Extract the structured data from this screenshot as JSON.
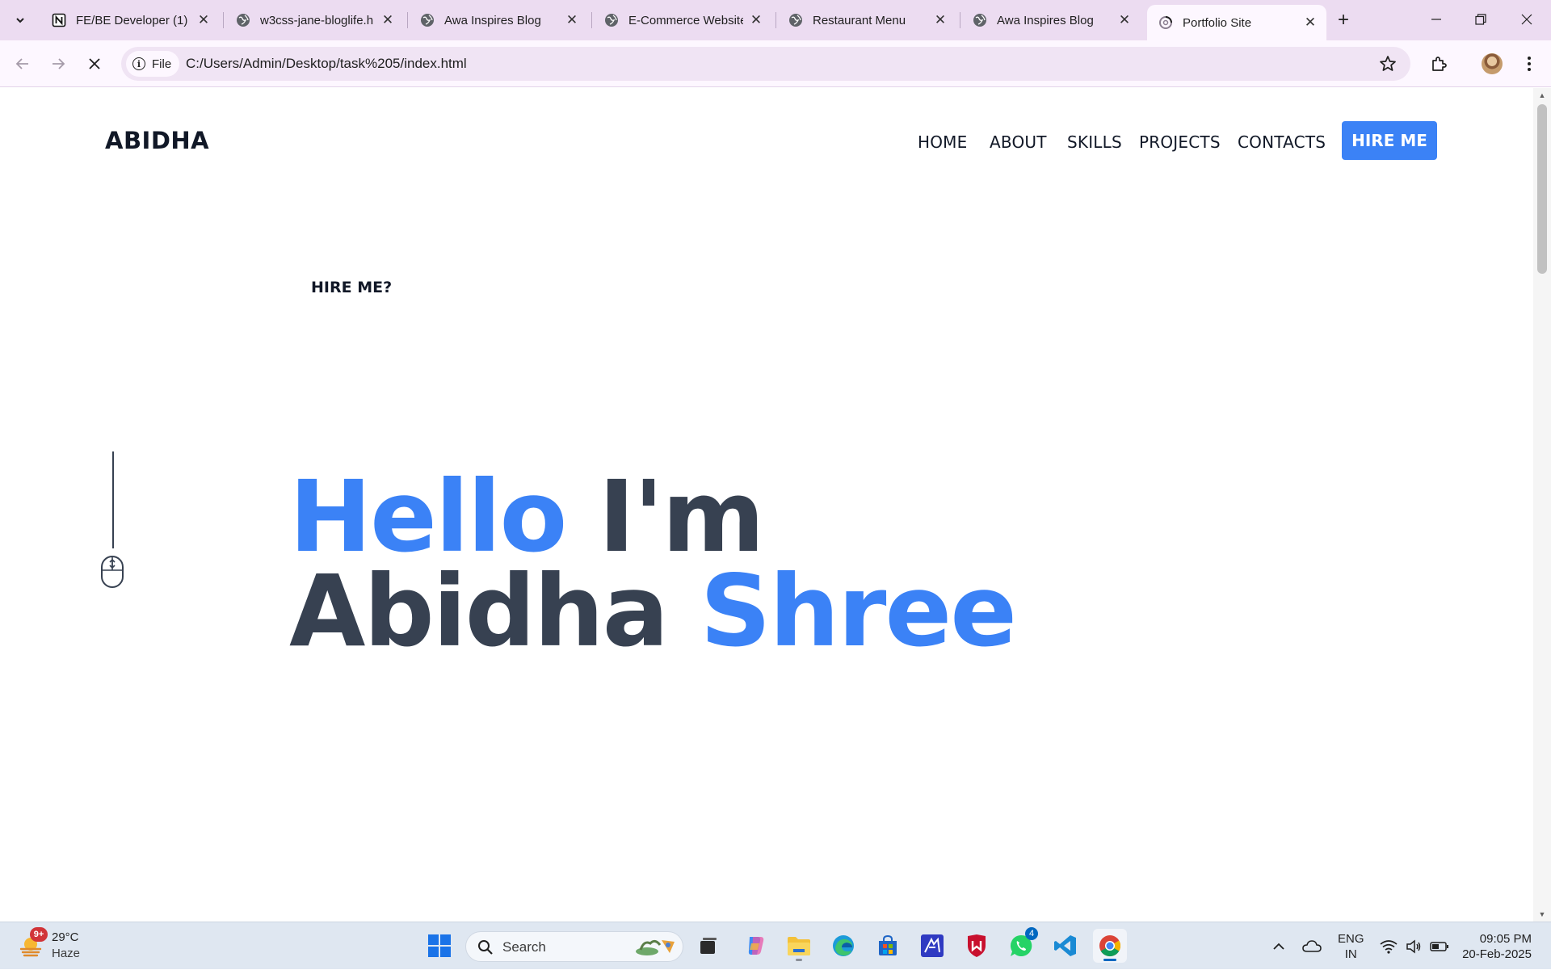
{
  "browser": {
    "tabs": [
      {
        "title": "FE/BE Developer (1)",
        "icon": "notion-icon"
      },
      {
        "title": "w3css-jane-bloglife.h",
        "icon": "globe-icon"
      },
      {
        "title": "Awa Inspires Blog",
        "icon": "globe-icon"
      },
      {
        "title": "E-Commerce Website",
        "icon": "globe-icon"
      },
      {
        "title": "Restaurant Menu",
        "icon": "globe-icon"
      },
      {
        "title": "Awa Inspires Blog",
        "icon": "globe-icon"
      },
      {
        "title": "Portfolio Site",
        "icon": "loading-icon",
        "active": true
      }
    ],
    "address": {
      "scheme_label": "File",
      "url": "C:/Users/Admin/Desktop/task%205/index.html"
    }
  },
  "page": {
    "logo": "ABIDHA",
    "nav": [
      "HOME",
      "ABOUT",
      "SKILLS",
      "PROJECTS",
      "CONTACTS"
    ],
    "hire_button": "HIRE ME",
    "hire_question": "HIRE ME?",
    "hero": {
      "line1_a": "Hello",
      "line1_b": "I'm",
      "line2_a": "Abidha",
      "line2_b": "Shree"
    },
    "colors": {
      "accent": "#3b82f6",
      "text": "#374151"
    }
  },
  "taskbar": {
    "weather": {
      "temp": "29°C",
      "desc": "Haze",
      "badge": "9+"
    },
    "search_placeholder": "Search",
    "whatsapp_badge": "4",
    "language": {
      "line1": "ENG",
      "line2": "IN"
    },
    "clock": {
      "time": "09:05 PM",
      "date": "20-Feb-2025"
    }
  }
}
